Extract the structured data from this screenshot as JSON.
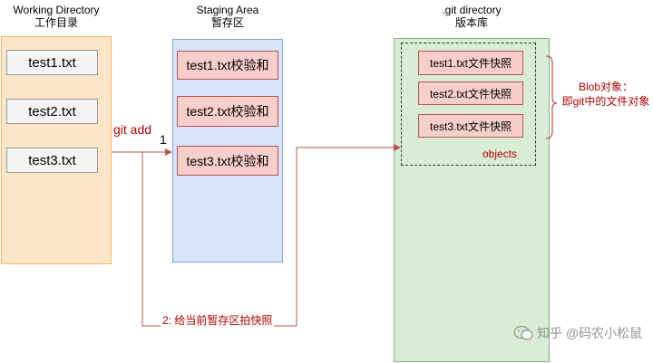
{
  "areas": {
    "working_directory": {
      "title": "Working Directory",
      "subtitle": "工作目录",
      "files": [
        "test1.txt",
        "test2.txt",
        "test3.txt"
      ]
    },
    "staging_area": {
      "title": "Staging Area",
      "subtitle": "暂存区",
      "items": [
        "test1.txt校验和",
        "test2.txt校验和",
        "test3.txt校验和"
      ]
    },
    "git_directory": {
      "title": ".git directory",
      "subtitle": "版本库",
      "objects_label": "objects",
      "items": [
        "test1.txt文件快照",
        "test2.txt文件快照",
        "test3.txt文件快照"
      ]
    }
  },
  "arrows": {
    "git_add_label": "git add",
    "step1_label": "1",
    "step2_label": "2: 给当前暂存区拍快照"
  },
  "blob_note": {
    "line1": "Blob对象：",
    "line2": "即git中的文件对象"
  },
  "watermark": {
    "text": "知乎 @码农小松鼠"
  },
  "colors": {
    "working_fill": "#fde6c8",
    "staging_fill": "#d7e4fb",
    "git_fill": "#d9ecd5",
    "item_fill": "#f8cecc",
    "arrow_red": "#b85450"
  }
}
